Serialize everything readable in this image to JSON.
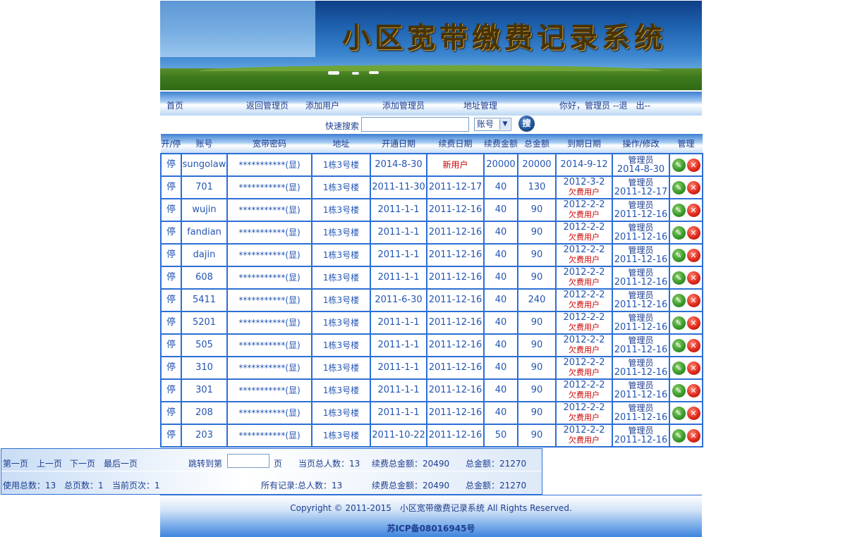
{
  "banner": {
    "title": "小区宽带缴费记录系统"
  },
  "nav": {
    "home": "首页",
    "back_admin": "返回管理页",
    "add_user": "添加用户",
    "add_admin": "添加管理员",
    "address_mgmt": "地址管理",
    "greeting": "你好，管理员 --退　出--"
  },
  "search": {
    "label": "快速搜索",
    "field_value": "",
    "select_value": "账号",
    "button": "搜"
  },
  "table": {
    "headers": [
      "开/停",
      "账号",
      "宽带密码",
      "地址",
      "开通日期",
      "续费日期",
      "续费金额",
      "总金额",
      "到期日期",
      "操作/修改",
      "管理"
    ],
    "rows": [
      {
        "status": "停",
        "account": "sungolaw",
        "password": "***********(显)",
        "address": "1栋3号楼",
        "open_date": "2014-8-30",
        "renew_date": "新用户",
        "renew_amount": "20000",
        "total": "20000",
        "expire_date": "2014-9-12",
        "expire_note": "",
        "op_user": "管理员",
        "op_date": "2014-8-30"
      },
      {
        "status": "停",
        "account": "701",
        "password": "***********(显)",
        "address": "1栋3号楼",
        "open_date": "2011-11-30",
        "renew_date": "2011-12-17",
        "renew_amount": "40",
        "total": "130",
        "expire_date": "2012-3-2",
        "expire_note": "欠费用户",
        "op_user": "管理员",
        "op_date": "2011-12-17"
      },
      {
        "status": "停",
        "account": "wujin",
        "password": "***********(显)",
        "address": "1栋3号楼",
        "open_date": "2011-1-1",
        "renew_date": "2011-12-16",
        "renew_amount": "40",
        "total": "90",
        "expire_date": "2012-2-2",
        "expire_note": "欠费用户",
        "op_user": "管理员",
        "op_date": "2011-12-16"
      },
      {
        "status": "停",
        "account": "fandian",
        "password": "***********(显)",
        "address": "1栋3号楼",
        "open_date": "2011-1-1",
        "renew_date": "2011-12-16",
        "renew_amount": "40",
        "total": "90",
        "expire_date": "2012-2-2",
        "expire_note": "欠费用户",
        "op_user": "管理员",
        "op_date": "2011-12-16"
      },
      {
        "status": "停",
        "account": "dajin",
        "password": "***********(显)",
        "address": "1栋3号楼",
        "open_date": "2011-1-1",
        "renew_date": "2011-12-16",
        "renew_amount": "40",
        "total": "90",
        "expire_date": "2012-2-2",
        "expire_note": "欠费用户",
        "op_user": "管理员",
        "op_date": "2011-12-16"
      },
      {
        "status": "停",
        "account": "608",
        "password": "***********(显)",
        "address": "1栋3号楼",
        "open_date": "2011-1-1",
        "renew_date": "2011-12-16",
        "renew_amount": "40",
        "total": "90",
        "expire_date": "2012-2-2",
        "expire_note": "欠费用户",
        "op_user": "管理员",
        "op_date": "2011-12-16"
      },
      {
        "status": "停",
        "account": "5411",
        "password": "***********(显)",
        "address": "1栋3号楼",
        "open_date": "2011-6-30",
        "renew_date": "2011-12-16",
        "renew_amount": "40",
        "total": "240",
        "expire_date": "2012-2-2",
        "expire_note": "欠费用户",
        "op_user": "管理员",
        "op_date": "2011-12-16"
      },
      {
        "status": "停",
        "account": "5201",
        "password": "***********(显)",
        "address": "1栋3号楼",
        "open_date": "2011-1-1",
        "renew_date": "2011-12-16",
        "renew_amount": "40",
        "total": "90",
        "expire_date": "2012-2-2",
        "expire_note": "欠费用户",
        "op_user": "管理员",
        "op_date": "2011-12-16"
      },
      {
        "status": "停",
        "account": "505",
        "password": "***********(显)",
        "address": "1栋3号楼",
        "open_date": "2011-1-1",
        "renew_date": "2011-12-16",
        "renew_amount": "40",
        "total": "90",
        "expire_date": "2012-2-2",
        "expire_note": "欠费用户",
        "op_user": "管理员",
        "op_date": "2011-12-16"
      },
      {
        "status": "停",
        "account": "310",
        "password": "***********(显)",
        "address": "1栋3号楼",
        "open_date": "2011-1-1",
        "renew_date": "2011-12-16",
        "renew_amount": "40",
        "total": "90",
        "expire_date": "2012-2-2",
        "expire_note": "欠费用户",
        "op_user": "管理员",
        "op_date": "2011-12-16"
      },
      {
        "status": "停",
        "account": "301",
        "password": "***********(显)",
        "address": "1栋3号楼",
        "open_date": "2011-1-1",
        "renew_date": "2011-12-16",
        "renew_amount": "40",
        "total": "90",
        "expire_date": "2012-2-2",
        "expire_note": "欠费用户",
        "op_user": "管理员",
        "op_date": "2011-12-16"
      },
      {
        "status": "停",
        "account": "208",
        "password": "***********(显)",
        "address": "1栋3号楼",
        "open_date": "2011-1-1",
        "renew_date": "2011-12-16",
        "renew_amount": "40",
        "total": "90",
        "expire_date": "2012-2-2",
        "expire_note": "欠费用户",
        "op_user": "管理员",
        "op_date": "2011-12-16"
      },
      {
        "status": "停",
        "account": "203",
        "password": "***********(显)",
        "address": "1栋3号楼",
        "open_date": "2011-10-22",
        "renew_date": "2011-12-16",
        "renew_amount": "50",
        "total": "90",
        "expire_date": "2012-2-2",
        "expire_note": "欠费用户",
        "op_user": "管理员",
        "op_date": "2011-12-16"
      }
    ]
  },
  "pager": {
    "first": "第一页",
    "prev": "上一页",
    "next": "下一页",
    "last": "最后一页",
    "jump_label": "跳转到第",
    "jump_value": "",
    "page_unit": "页",
    "page_users": "当页总人数：13",
    "page_renew_total": "续费总金额：20490",
    "page_total": "总金额：21270",
    "used_total": "使用总数：13",
    "total_pages": "总页数：1",
    "current_page": "当前页次：1",
    "all_records": "所有记录:总人数：13",
    "all_renew_total": "续费总金额：20490",
    "all_total": "总金额：21270"
  },
  "footer": {
    "copyright": "Copyright © 2011-2015　小区宽带缴费记录系统 All Rights Reserved.",
    "icp": "苏ICP备08016945号"
  },
  "colors": {
    "link": "#1d3d8f",
    "table_border": "#2d6fd6",
    "alert": "#cc0000"
  }
}
